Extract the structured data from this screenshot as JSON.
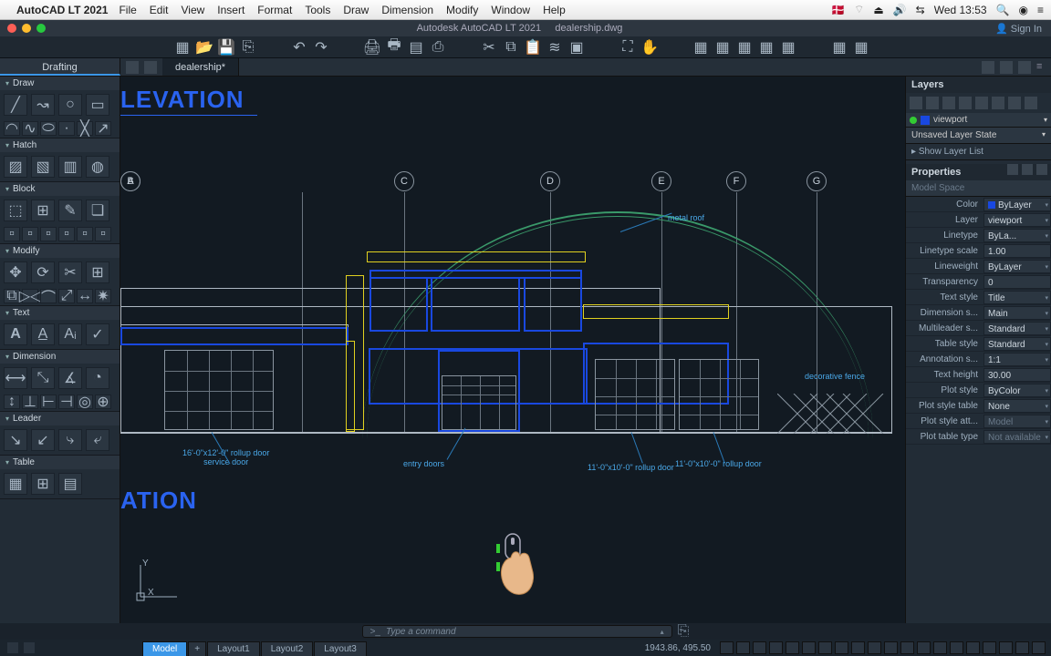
{
  "mac": {
    "app_name": "AutoCAD LT 2021",
    "menus": [
      "File",
      "Edit",
      "View",
      "Insert",
      "Format",
      "Tools",
      "Draw",
      "Dimension",
      "Modify",
      "Window",
      "Help"
    ],
    "clock": "Wed 13:53"
  },
  "titlebar": {
    "app": "Autodesk AutoCAD LT 2021",
    "doc": "dealership.dwg",
    "signin": "Sign In"
  },
  "palette_header": "Drafting",
  "doc_tab": "dealership*",
  "left_sections": [
    "Draw",
    "Hatch",
    "Block",
    "Modify",
    "Text",
    "Dimension",
    "Leader",
    "Table"
  ],
  "layers": {
    "title": "Layers",
    "current": "viewport",
    "state": "Unsaved Layer State",
    "showlist": "Show Layer List"
  },
  "properties": {
    "title": "Properties",
    "space": "Model Space",
    "rows": [
      {
        "label": "Color",
        "value": "ByLayer",
        "swatch": "#1948e0"
      },
      {
        "label": "Layer",
        "value": "viewport"
      },
      {
        "label": "Linetype",
        "value": "ByLa..."
      },
      {
        "label": "Linetype scale",
        "value": "1.00",
        "noarrow": true
      },
      {
        "label": "Lineweight",
        "value": "ByLayer"
      },
      {
        "label": "Transparency",
        "value": "0",
        "noarrow": true
      },
      {
        "label": "Text style",
        "value": "Title"
      },
      {
        "label": "Dimension s...",
        "value": "Main"
      },
      {
        "label": "Multileader s...",
        "value": "Standard"
      },
      {
        "label": "Table style",
        "value": "Standard"
      },
      {
        "label": "Annotation s...",
        "value": "1:1"
      },
      {
        "label": "Text height",
        "value": "30.00",
        "noarrow": true
      },
      {
        "label": "Plot style",
        "value": "ByColor"
      },
      {
        "label": "Plot style table",
        "value": "None"
      },
      {
        "label": "Plot style att...",
        "value": "Model",
        "dim": true
      },
      {
        "label": "Plot table type",
        "value": "Not available",
        "dim": true
      }
    ]
  },
  "command_placeholder": "Type a command",
  "model_tabs": [
    "Model",
    "Layout1",
    "Layout2",
    "Layout3"
  ],
  "coords": "1943.86, 495.50",
  "canvas": {
    "title1": "LEVATION",
    "title2": "ATION",
    "grid_letters": [
      "A",
      "B",
      "C",
      "D",
      "E",
      "F",
      "G"
    ],
    "annotations": {
      "metal_roof": "metal roof",
      "decorative_fence": "decorative fence",
      "service_door": "16'-0\"x12'-0\" rollup door\nservice door",
      "entry_doors": "entry doors",
      "rollup1": "11'-0\"x10'-0\" rollup door",
      "rollup2": "11'-0\"x10'-0\" rollup door"
    }
  }
}
